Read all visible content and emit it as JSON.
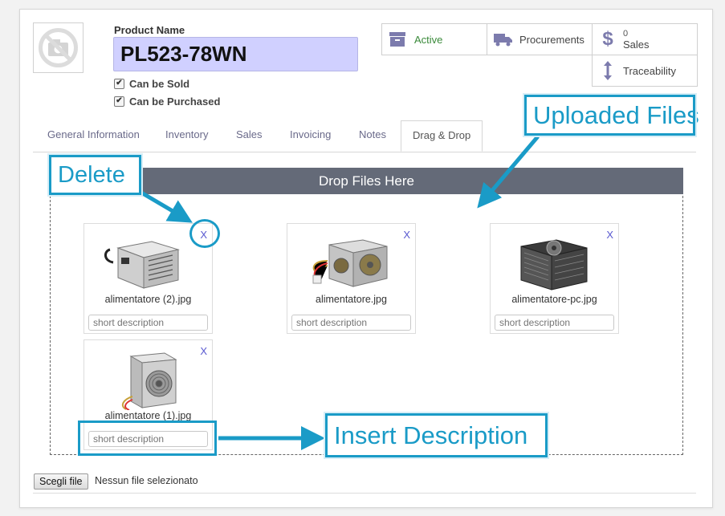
{
  "product": {
    "name_label": "Product Name",
    "name_value": "PL523-78WN",
    "can_be_sold": "Can be Sold",
    "can_be_purchased": "Can be Purchased"
  },
  "smart_buttons": {
    "active": "Active",
    "procurements": "Procurements",
    "sales_count": "0",
    "sales_label": "Sales",
    "traceability": "Traceability"
  },
  "tabs": [
    "General Information",
    "Inventory",
    "Sales",
    "Invoicing",
    "Notes",
    "Drag & Drop"
  ],
  "active_tab": "Drag & Drop",
  "dropzone": {
    "title": "Drop Files Here",
    "files": [
      {
        "name": "alimentatore (2).jpg",
        "description_placeholder": "short description",
        "delete": "X"
      },
      {
        "name": "alimentatore.jpg",
        "description_placeholder": "short description",
        "delete": "X"
      },
      {
        "name": "alimentatore-pc.jpg",
        "description_placeholder": "short description",
        "delete": "X"
      },
      {
        "name": "alimentatore (1).jpg",
        "description_placeholder": "short description",
        "delete": "X"
      }
    ]
  },
  "file_input": {
    "button": "Scegli file",
    "status": "Nessun file selezionato"
  },
  "annotations": {
    "delete": "Delete",
    "uploaded_files": "Uploaded Files",
    "insert_description": "Insert Description"
  },
  "colors": {
    "accent_callout": "#1a9bc7",
    "dropbar": "#646a78",
    "name_field": "#d0d0ff",
    "odoo_purple": "#7c7bad"
  }
}
